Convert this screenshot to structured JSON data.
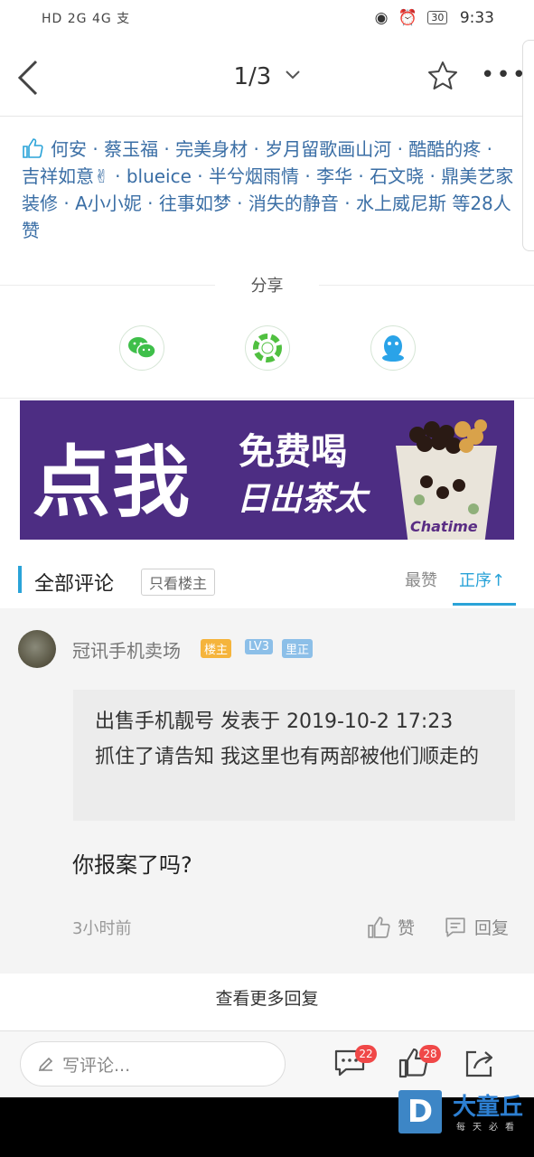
{
  "status": {
    "left": "HD 2G 4G 支",
    "battery": "30",
    "time": "9:33"
  },
  "nav": {
    "page_indicator": "1/3"
  },
  "likes": {
    "names": "何安 · 蔡玉福 · 完美身材 · 岁月留歌画山河 · 酷酷的疼 · 吉祥如意✌ · blueice · 半兮烟雨情 · 李华 · 石文晓 · 鼎美艺家装修 · A小小妮 · 往事如梦 · 消失的静音 · 水上威尼斯 等28人赞"
  },
  "share": {
    "label": "分享",
    "targets": [
      "wechat-icon",
      "moments-icon",
      "qq-icon"
    ],
    "colors": {
      "wechat": "#3fbf4a",
      "moments": "#50c040",
      "qq": "#2aa3e8"
    }
  },
  "banner": {
    "big_text": "点我",
    "small_text": "免费喝",
    "brand_text": "日出茶太",
    "cup_text": "Chatime"
  },
  "comments": {
    "title": "全部评论",
    "owner_only": "只看楼主",
    "sort_hot": "最赞",
    "sort_asc": "正序↑",
    "accent": "#2aa3d8"
  },
  "comment": {
    "username": "冠讯手机卖场",
    "badges": [
      "楼主",
      "LV3",
      "里正"
    ],
    "quote_line1": "出售手机靓号 发表于 2019-10-2 17:23",
    "quote_line2": "抓住了请告知  我这里也有两部被他们顺走的",
    "reply": "你报案了吗?",
    "time": "3小时前",
    "like_label": "赞",
    "reply_label": "回复"
  },
  "more_replies": "查看更多回复",
  "bottom": {
    "placeholder": "写评论...",
    "comment_count": "22",
    "like_count": "28"
  },
  "watermark": {
    "name": "大童丘",
    "slogan": "每天必看",
    "logo": "D"
  }
}
